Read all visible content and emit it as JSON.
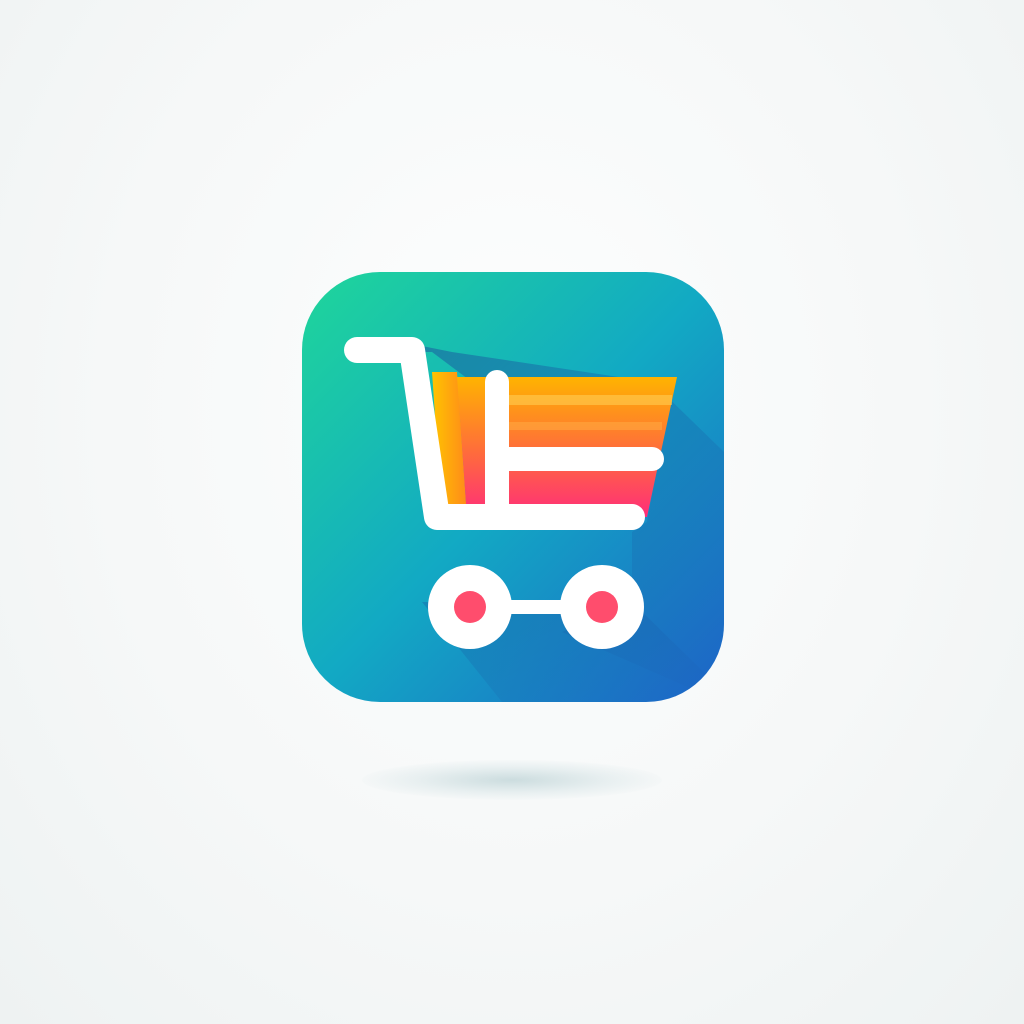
{
  "icon": {
    "name": "shopping-cart-icon",
    "tile_gradient": [
      "#1fd69a",
      "#12a9c4",
      "#1e63c8"
    ],
    "basket_gradient": [
      "#ffb300",
      "#ff6a3d",
      "#ff2d7a"
    ],
    "cart_color": "#ffffff",
    "wheel_color": "#ff4d6d",
    "long_shadow_color": "#1a4f9e"
  },
  "background": {
    "color": "#f6f8f8"
  }
}
